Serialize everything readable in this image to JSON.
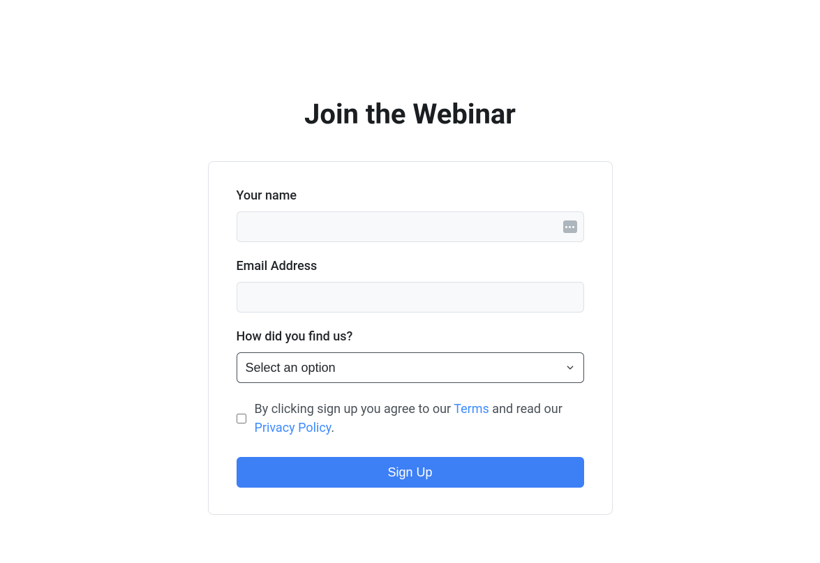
{
  "title": "Join the Webinar",
  "form": {
    "name": {
      "label": "Your name",
      "value": ""
    },
    "email": {
      "label": "Email Address",
      "value": ""
    },
    "source": {
      "label": "How did you find us?",
      "selected": "Select an option"
    },
    "consent": {
      "text_before": "By clicking sign up you agree to our ",
      "terms_link": "Terms",
      "text_middle": " and read our ",
      "privacy_link": "Privacy Policy",
      "text_after": "."
    },
    "submit_label": "Sign Up"
  }
}
